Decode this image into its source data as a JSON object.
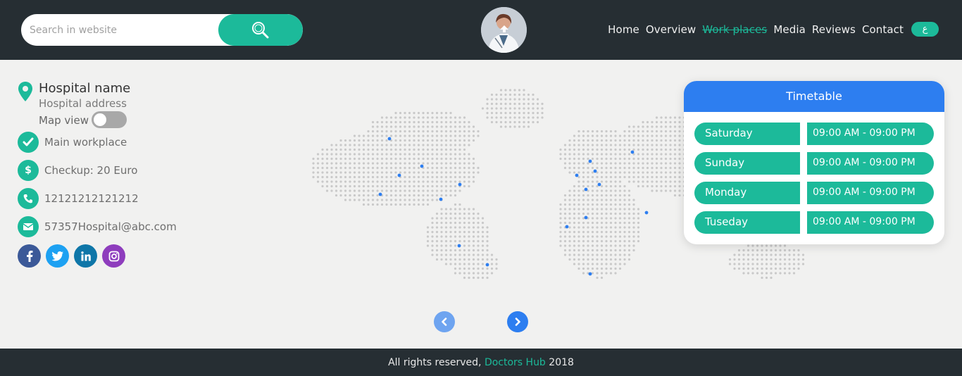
{
  "header": {
    "search_placeholder": "Search in website",
    "nav": [
      {
        "label": "Home",
        "active": false
      },
      {
        "label": "Overview",
        "active": false
      },
      {
        "label": "Work places",
        "active": true
      },
      {
        "label": "Media",
        "active": false
      },
      {
        "label": "Reviews",
        "active": false
      },
      {
        "label": "Contact",
        "active": false
      }
    ],
    "lang_label": "ع"
  },
  "hospital": {
    "name": "Hospital name",
    "address": "Hospital address",
    "map_view_label": "Map view",
    "map_view_enabled": false,
    "main_workplace": "Main workplace",
    "checkup": "Checkup: 20 Euro",
    "phone": "12121212121212",
    "email": "57357Hospital@abc.com"
  },
  "socials": [
    "facebook",
    "twitter",
    "linkedin",
    "instagram"
  ],
  "timetable": {
    "title": "Timetable",
    "rows": [
      {
        "day": "Saturday",
        "time": "09:00 AM - 09:00 PM"
      },
      {
        "day": "Sunday",
        "time": "09:00 AM - 09:00 PM"
      },
      {
        "day": "Monday",
        "time": "09:00 AM - 09:00 PM"
      },
      {
        "day": "Tuseday",
        "time": "09:00 AM - 09:00 PM"
      }
    ]
  },
  "footer": {
    "text": "All rights reserved,",
    "brand": "Doctors Hub",
    "year": "2018"
  },
  "colors": {
    "accent": "#1cba9a",
    "blue": "#2d7ef0",
    "dark": "#262e33",
    "background": "#f1f1f0"
  }
}
